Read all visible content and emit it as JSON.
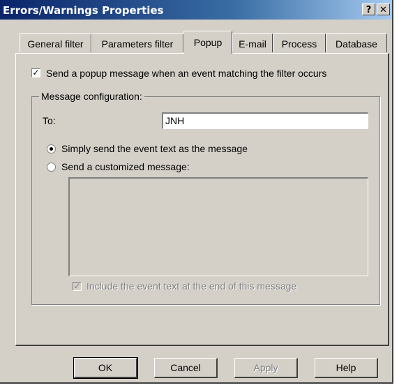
{
  "window": {
    "title": "Errors/Warnings Properties",
    "help_label": "?",
    "close_label": "✕"
  },
  "tabs": [
    {
      "label": "General filter",
      "active": false
    },
    {
      "label": "Parameters filter",
      "active": false
    },
    {
      "label": "Popup",
      "active": true
    },
    {
      "label": "E-mail",
      "active": false
    },
    {
      "label": "Process",
      "active": false
    },
    {
      "label": "Database",
      "active": false
    }
  ],
  "popup": {
    "send_popup_label": "Send a popup message when an event matching the filter occurs",
    "send_popup_checked": true,
    "group_title": "Message configuration:",
    "to_label": "To:",
    "to_value": "JNH",
    "option_simple_label": "Simply send the event text as the message",
    "option_simple_selected": true,
    "option_custom_label": "Send a customized message:",
    "option_custom_selected": false,
    "custom_message_value": "",
    "include_event_label": "Include the event text at the end of this message",
    "include_event_checked": true,
    "include_event_enabled": false
  },
  "buttons": {
    "ok": "OK",
    "cancel": "Cancel",
    "apply": "Apply",
    "help": "Help"
  },
  "colors": {
    "title_gradient_start": "#0a246a",
    "title_gradient_end": "#a6caf0",
    "face": "#d4d0c8"
  }
}
